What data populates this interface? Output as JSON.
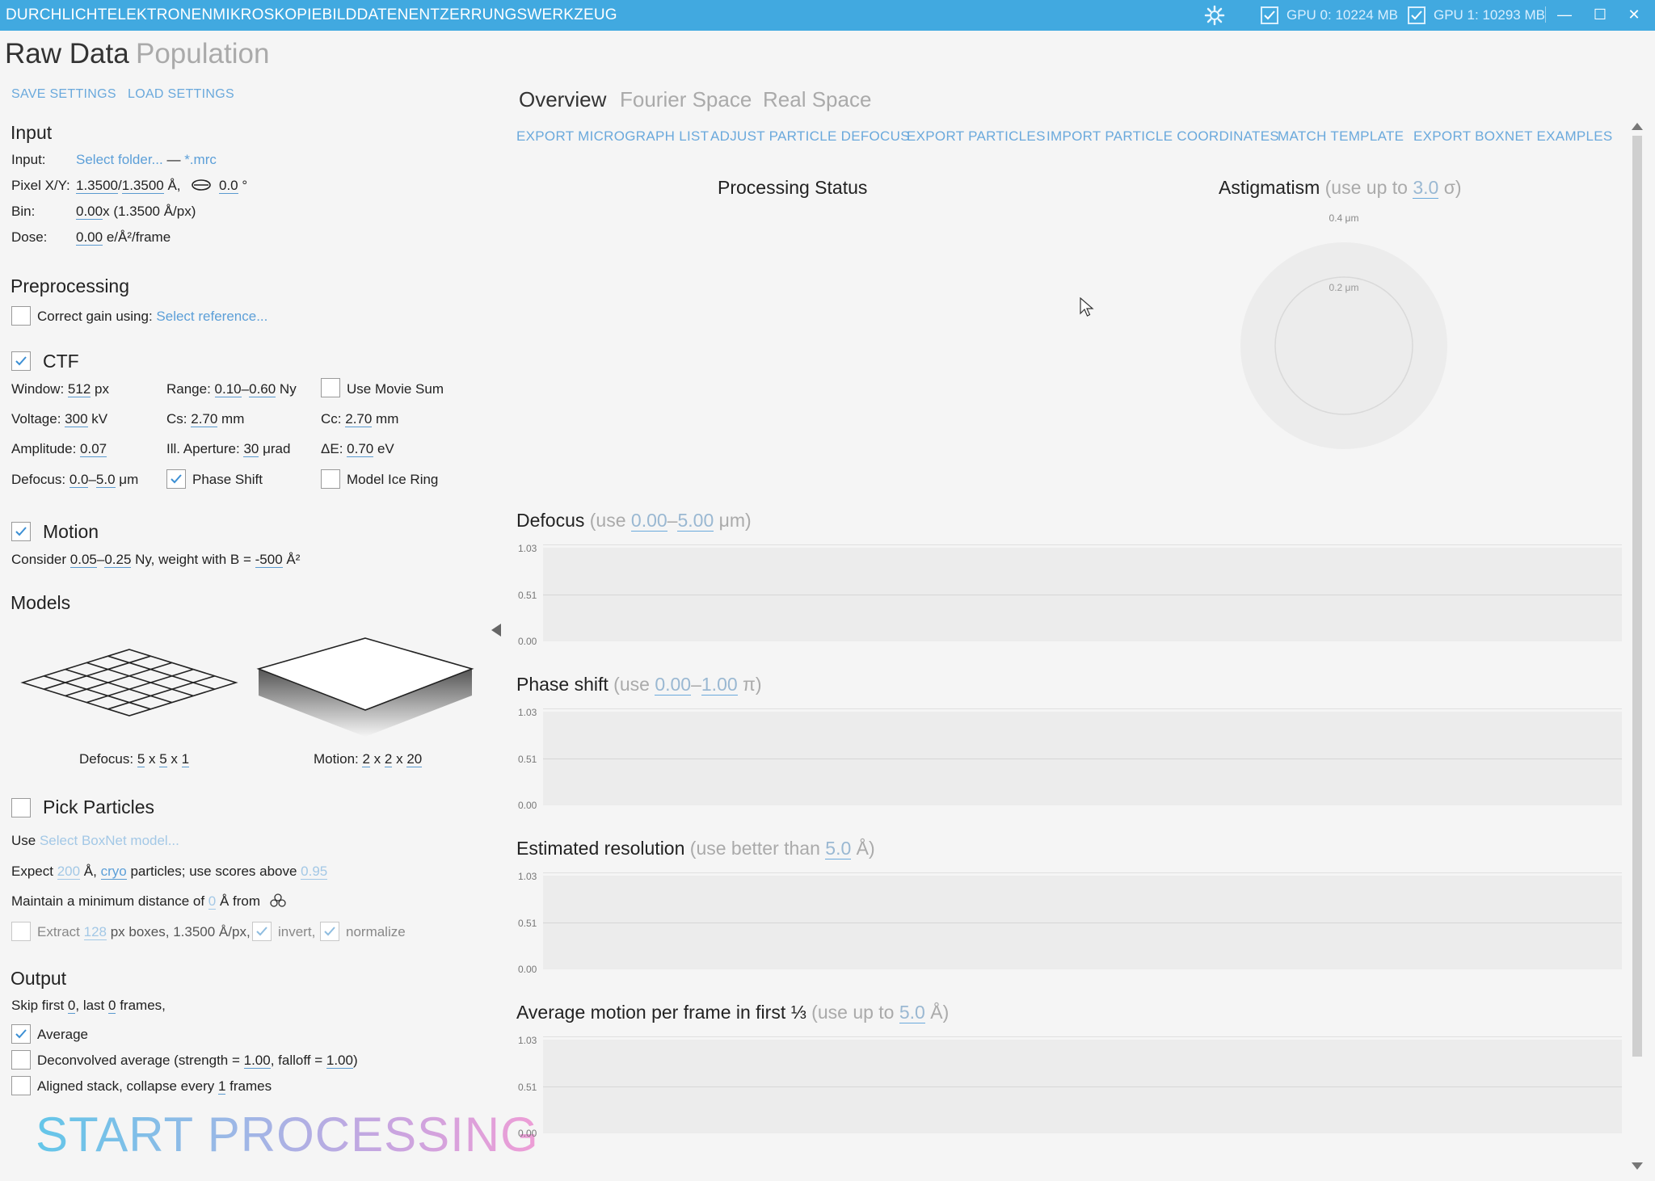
{
  "titlebar": {
    "title": "DURCHLICHTELEKTRONENMIKROSKOPIEBILDDATENENTZERRUNGSWERKZEUG",
    "gpu0": "GPU 0: 10224 MB",
    "gpu1": "GPU 1: 10293 MB",
    "minimize": "—",
    "maximize": "☐",
    "close": "✕"
  },
  "main_tabs": [
    "Raw Data",
    "Population"
  ],
  "settings": {
    "save": "SAVE SETTINGS",
    "load": "LOAD SETTINGS"
  },
  "input": {
    "title": "Input",
    "input_label": "Input:",
    "folder": "Select folder...",
    "dash": " — ",
    "ext": "*.mrc",
    "pixel_label": "Pixel X/Y:",
    "pixel_x": "1.3500",
    "pixel_sep": "/",
    "pixel_y": "1.3500",
    "pixel_unit": " Å,",
    "angle": "0.0",
    "angle_unit": " °",
    "bin_label": "Bin:",
    "bin": "0.00",
    "bin_suffix": "x (1.3500 Å/px)",
    "dose_label": "Dose:",
    "dose": "0.00",
    "dose_unit": " e/Å²/frame"
  },
  "preprocessing": {
    "title": "Preprocessing",
    "gain_label": "Correct gain using: ",
    "gain_ref": "Select reference..."
  },
  "ctf": {
    "title": "CTF",
    "window_label": "Window: ",
    "window": "512",
    "window_unit": " px",
    "range_label": "Range: ",
    "range_lo": "0.10",
    "range_sep": "–",
    "range_hi": "0.60",
    "range_unit": " Ny",
    "movie_sum": "Use Movie Sum",
    "voltage_label": "Voltage: ",
    "voltage": "300",
    "voltage_unit": " kV",
    "cs_label": "Cs: ",
    "cs": "2.70",
    "cs_unit": " mm",
    "cc_label": "Cc: ",
    "cc": "2.70",
    "cc_unit": " mm",
    "amp_label": "Amplitude: ",
    "amp": "0.07",
    "ill_label": "Ill. Aperture: ",
    "ill": "30",
    "ill_unit": " μrad",
    "de_label": "ΔE: ",
    "de": "0.70",
    "de_unit": " eV",
    "defocus_label": "Defocus: ",
    "defocus_lo": "0.0",
    "defocus_sep": "–",
    "defocus_hi": "5.0",
    "defocus_unit": " μm",
    "phase_shift": "Phase Shift",
    "ice_ring": "Model Ice Ring"
  },
  "motion": {
    "title": "Motion",
    "consider": "Consider ",
    "lo": "0.05",
    "sep": "–",
    "hi": "0.25",
    "weight": " Ny, weight with B = ",
    "b": "-500",
    "unit": " Å²"
  },
  "models": {
    "title": "Models",
    "defocus_label": "Defocus: ",
    "d1": "5",
    "d2": "5",
    "d3": "1",
    "motion_label": "Motion: ",
    "m1": "2",
    "m2": "2",
    "m3": "20",
    "x": " x "
  },
  "pick": {
    "title": "Pick Particles",
    "use": "Use ",
    "model": "Select BoxNet model...",
    "expect": "Expect ",
    "size": "200",
    "size_unit": " Å, ",
    "type": "cryo",
    "particles": " particles; use scores above ",
    "score": "0.95",
    "min_dist": "Maintain a minimum distance of ",
    "dist": "0",
    "from": " Å from",
    "extract": "Extract ",
    "box": "128",
    "box_suffix": " px boxes, 1.3500 Å/px,",
    "invert": "invert,",
    "normalize": "normalize"
  },
  "output": {
    "title": "Output",
    "skip": "Skip first ",
    "first": "0",
    "last_label": ", last ",
    "last": "0",
    "frames": " frames,",
    "average": "Average",
    "deconv": "Deconvolved average (strength = ",
    "strength": "1.00",
    "falloff_label": ", falloff = ",
    "falloff": "1.00",
    "deconv_end": ")",
    "aligned": "Aligned stack, collapse every ",
    "collapse": "1",
    "aligned_end": " frames"
  },
  "start": "START PROCESSING",
  "sub_tabs": [
    "Overview",
    "Fourier Space",
    "Real Space"
  ],
  "actions": [
    "EXPORT MICROGRAPH LIST",
    "ADJUST PARTICLE DEFOCUS",
    "EXPORT PARTICLES",
    "IMPORT PARTICLE COORDINATES",
    "MATCH TEMPLATE",
    "EXPORT BOXNET EXAMPLES"
  ],
  "status": {
    "title": "Processing Status"
  },
  "astig": {
    "title": "Astigmatism",
    "hint_pre": " (use up to ",
    "value": "3.0",
    "hint_post": " σ)",
    "outer_label": "0.4 μm",
    "inner_label": "0.2 μm"
  },
  "charts": [
    {
      "title": "Defocus",
      "hint_pre": " (use ",
      "v1": "0.00",
      "sep": "–",
      "v2": "5.00",
      "hint_post": " μm)",
      "ticks": [
        "1.03",
        "0.51",
        "0.00"
      ]
    },
    {
      "title": "Phase shift",
      "hint_pre": " (use ",
      "v1": "0.00",
      "sep": "–",
      "v2": "1.00",
      "hint_post": " π)",
      "ticks": [
        "1.03",
        "0.51",
        "0.00"
      ]
    },
    {
      "title": "Estimated resolution",
      "hint_pre": " (use better than ",
      "v1": "5.0",
      "hint_post": " Å)",
      "ticks": [
        "1.03",
        "0.51",
        "0.00"
      ]
    },
    {
      "title": "Average motion per frame in first ⅓",
      "hint_pre": " (use up to ",
      "v1": "5.0",
      "hint_post": " Å)",
      "ticks": [
        "1.03",
        "0.51",
        "0.00"
      ]
    }
  ],
  "colors": {
    "titlebar": "#41a9e0",
    "accent": "#5c9fd8"
  }
}
